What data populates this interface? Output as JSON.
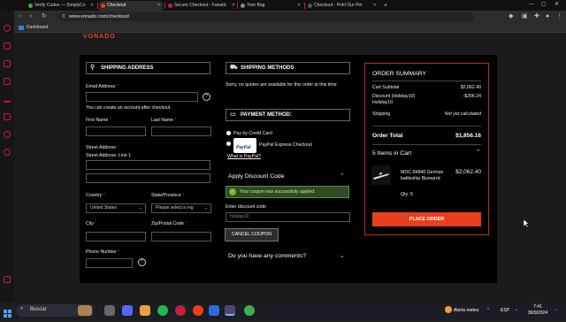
{
  "browser": {
    "tabs": [
      {
        "label": "Verify Codes — SimplyCo",
        "active": false
      },
      {
        "label": "Checkout",
        "active": true
      },
      {
        "label": "Secure Checkout - Fanatic",
        "active": false
      },
      {
        "label": "Your Bag",
        "active": false
      },
      {
        "label": "Checkout - Print Our Pet",
        "active": false
      }
    ],
    "url": "www.vonado.com/checkout/",
    "bookmark": "Dashboard"
  },
  "site": {
    "logo": "VONADO"
  },
  "shipping_address": {
    "heading": "SHIPPING ADDRESS",
    "email_label": "Email Address",
    "email_value": "",
    "email_note": "You can create an account after checkout.",
    "first_name_label": "First Name",
    "last_name_label": "Last Name",
    "street_label": "Street Address",
    "street_line1_label": "Street Address: Line 1",
    "country_label": "Country",
    "country_value": "United States",
    "state_label": "State/Province",
    "state_value": "Please select a reg",
    "city_label": "City",
    "zip_label": "Zip/Postal Code",
    "phone_label": "Phone Number",
    "required_mark": "*",
    "help_mark": "?"
  },
  "shipping_methods": {
    "heading": "SHIPPING METHODS",
    "note": "Sorry, no quotes are available for this order at this time"
  },
  "payment": {
    "heading": "PAYMENT METHOD:",
    "option_card": "Pay by Credit Card",
    "option_paypal": "PayPal Express Checkout",
    "paypal_logo": "PayPal",
    "paypal_link": "What is PayPal?"
  },
  "discount": {
    "heading": "Apply Discount Code",
    "success_message": "Your coupon was successfully applied.",
    "code_label": "Enter discount code",
    "code_value": "holiday10",
    "cancel_button": "CANCEL COUPON"
  },
  "comments": {
    "heading": "Do you have any comments?"
  },
  "summary": {
    "heading": "ORDER SUMMARY",
    "subtotal_label": "Cart Subtotal",
    "subtotal_value": "$2,062.40",
    "discount_label": "Discount (Holiday10)",
    "discount_label2": "Holiday10",
    "discount_value": "-$206.24",
    "shipping_label": "Shipping",
    "shipping_value": "Not yet calculated",
    "total_label": "Order Total",
    "total_value": "$1,856.16",
    "items_label": "5 Items in Cart",
    "item_name": "MOC-84840 German battleship Bismarck",
    "item_price": "$2,062.40",
    "item_qty": "Qty: 5",
    "place_order": "PLACE ORDER"
  },
  "taskbar": {
    "search_placeholder": "Buscar",
    "weather": "Alerta meteo",
    "lang": "ESP",
    "time": "7:41",
    "date": "30/9/2024"
  },
  "colors": {
    "accent": "#e8401c",
    "browser_red": "#d2143a",
    "success": "#6fb33f"
  }
}
